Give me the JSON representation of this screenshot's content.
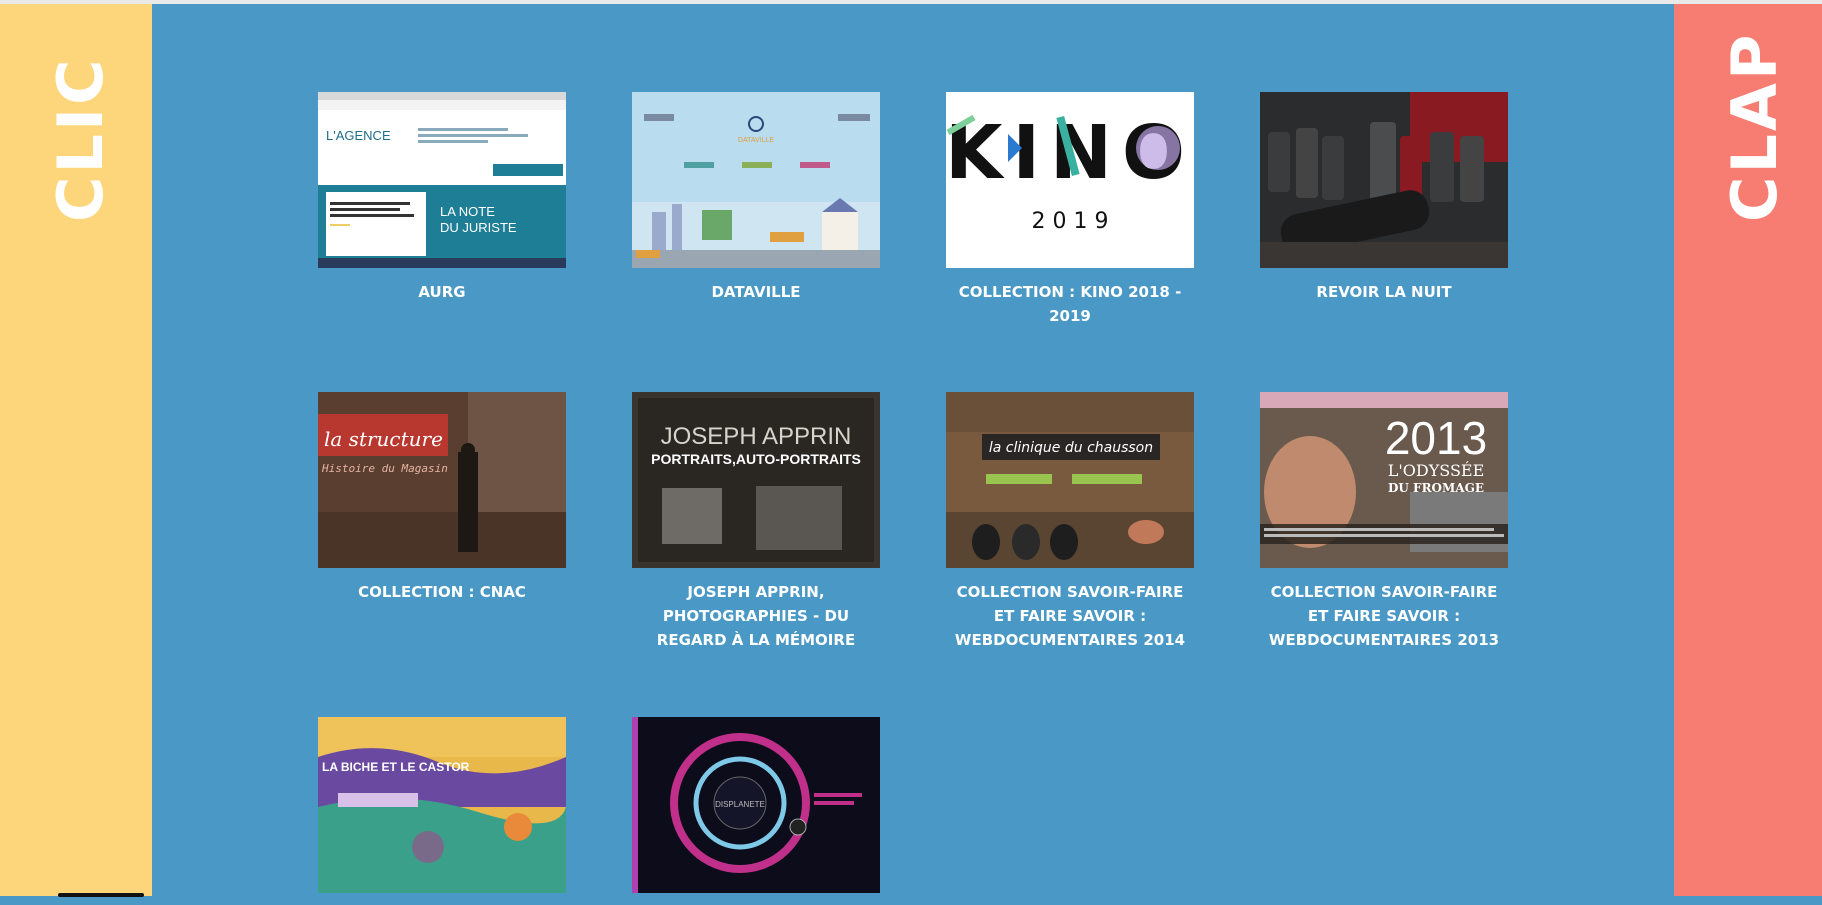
{
  "sidebar_left": {
    "label": "CLIC",
    "color": "#fdd57a"
  },
  "sidebar_right": {
    "label": "CLAP",
    "color": "#f77c72"
  },
  "background": "#4a98c5",
  "items": [
    {
      "caption": "AURG",
      "thumb_text": [
        "L'AGENCE",
        "LA NOTE",
        "DU JURISTE"
      ]
    },
    {
      "caption": "DATAVILLE",
      "thumb_text": [
        "DATAVILLE"
      ]
    },
    {
      "caption": "COLLECTION : KINO 2018 - 2019",
      "thumb_text": [
        "KINO",
        "2 0 1 9"
      ]
    },
    {
      "caption": "REVOIR LA NUIT",
      "thumb_text": []
    },
    {
      "caption": "COLLECTION : CNAC",
      "thumb_text": [
        "la structure",
        "Histoire du Magasin"
      ]
    },
    {
      "caption": "JOSEPH APPRIN, PHOTOGRAPHIES - DU REGARD À LA MÉMOIRE",
      "thumb_text": [
        "JOSEPH APPRIN",
        "PORTRAITS,AUTO-PORTRAITS"
      ]
    },
    {
      "caption": "COLLECTION SAVOIR-FAIRE ET FAIRE SAVOIR : WEBDOCUMENTAIRES 2014",
      "thumb_text": [
        "la clinique du chausson"
      ]
    },
    {
      "caption": "COLLECTION SAVOIR-FAIRE ET FAIRE SAVOIR : WEBDOCUMENTAIRES 2013",
      "thumb_text": [
        "2013",
        "L'ODYSSÉE",
        "DU FROMAGE"
      ]
    },
    {
      "caption": "",
      "thumb_text": [
        "LA BICHE ET LE CASTOR"
      ]
    },
    {
      "caption": "",
      "thumb_text": [
        "DISPLANETE"
      ]
    }
  ]
}
